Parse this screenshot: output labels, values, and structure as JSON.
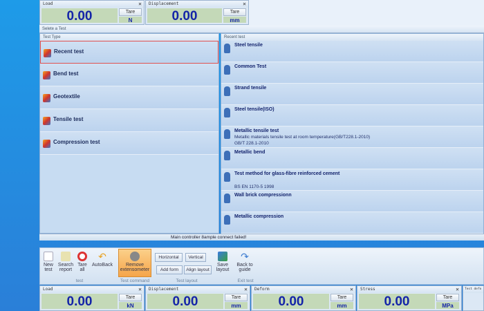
{
  "top_meters": [
    {
      "label": "Load",
      "value": "0.00",
      "tare": "Tare",
      "unit": "N"
    },
    {
      "label": "Displacement",
      "value": "0.00",
      "tare": "Tare",
      "unit": "mm"
    }
  ],
  "select_bar": "Selete a Test",
  "test_type": {
    "header": "Test Type",
    "items": [
      "Recent test",
      "Bend test",
      "Geotextile",
      "Tensile test",
      "Compression test"
    ],
    "selected": "Recent test"
  },
  "recent": {
    "header": "Recent test",
    "items": [
      {
        "title": "Steel tensile"
      },
      {
        "title": "Common Test"
      },
      {
        "title": "Strand tensile"
      },
      {
        "title": "Steel tensile(ISO)"
      },
      {
        "title": "Metallic tensile test",
        "sub1": "Metallic materials tensile test at room temperature(GB/T228.1-2010)",
        "sub2": "GB/T 228.1-2010"
      },
      {
        "title": "Metallic bend"
      },
      {
        "title": "Test method for glass-fibre reinforced cement",
        "sub2": "BS EN 1170-5 1998"
      },
      {
        "title": "Wall brick compressionn"
      },
      {
        "title": "Metallic compression"
      }
    ]
  },
  "status": "Main controller 8ample connect failed!",
  "toolbar": {
    "new_test": "New test",
    "search_report": "Search report",
    "tare_all": "Tare all",
    "autoback": "AutoBack",
    "remove_ext": "Remove extensometer",
    "horizontal": "Horizontal",
    "vertical": "Vertical",
    "add_form": "Add form",
    "align_layout": "Align layout",
    "save_layout": "Save layout",
    "back_guide": "Back to guide",
    "groups": {
      "test": "test",
      "test_command": "Test command",
      "test_layout": "Test layout",
      "exit_test": "Exit test"
    }
  },
  "bottom_meters": [
    {
      "label": "Load",
      "value": "0.00",
      "tare": "Tare",
      "unit": "kN"
    },
    {
      "label": "Displacement",
      "value": "0.00",
      "tare": "Tare",
      "unit": "mm"
    },
    {
      "label": "Deform",
      "value": "0.00",
      "tare": "Tare",
      "unit": "mm"
    },
    {
      "label": "Stress",
      "value": "0.00",
      "tare": "Tare",
      "unit": "MPa"
    },
    {
      "label": "Test defo"
    }
  ],
  "colors": {
    "value_text": "#1424a8",
    "value_bg": "#c4d9b8",
    "accent_button": "#f5a54a",
    "desktop": "#1e9be8"
  }
}
